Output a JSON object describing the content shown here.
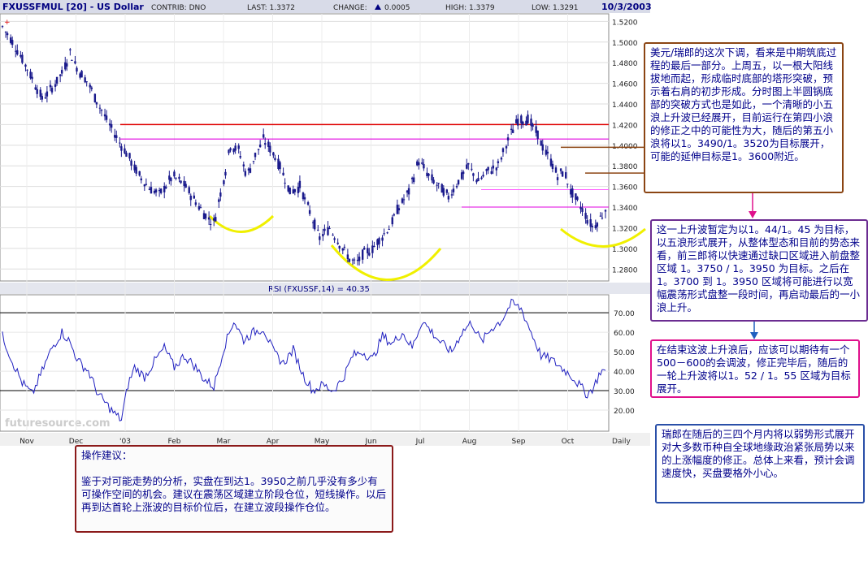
{
  "header": {
    "symbol": "FXUSSFMUL [20] - US Dollar",
    "contrib": "CONTRIB: DNO",
    "last": "LAST: 1.3372",
    "change_label": "CHANGE:",
    "change_value": "0.0005",
    "high": "HIGH: 1.3379",
    "low": "LOW: 1.3291",
    "date": "10/3/2003"
  },
  "rsi_label": "RSI (FXUSSF,14) = 40.35",
  "watermark": "futuresource.com",
  "period_label": "Daily",
  "chart_data": [
    {
      "type": "candlestick",
      "title": "FXUSSFMUL [20] - US Dollar",
      "ylim": [
        1.27,
        1.525
      ],
      "y_ticks": [
        1.28,
        1.3,
        1.32,
        1.34,
        1.36,
        1.38,
        1.4,
        1.42,
        1.44,
        1.46,
        1.48,
        1.5,
        1.52
      ],
      "x_ticks": [
        "Nov",
        "Dec",
        "'03",
        "Feb",
        "Mar",
        "Apr",
        "May",
        "Jun",
        "Jul",
        "Aug",
        "Sep",
        "Oct"
      ],
      "anchors": [
        [
          0,
          1.515
        ],
        [
          4,
          1.505
        ],
        [
          10,
          1.49
        ],
        [
          18,
          1.465
        ],
        [
          24,
          1.445
        ],
        [
          30,
          1.455
        ],
        [
          36,
          1.47
        ],
        [
          41,
          1.49
        ],
        [
          45,
          1.475
        ],
        [
          52,
          1.46
        ],
        [
          58,
          1.44
        ],
        [
          63,
          1.425
        ],
        [
          70,
          1.405
        ],
        [
          76,
          1.39
        ],
        [
          82,
          1.372
        ],
        [
          88,
          1.36
        ],
        [
          95,
          1.352
        ],
        [
          103,
          1.37
        ],
        [
          110,
          1.362
        ],
        [
          117,
          1.345
        ],
        [
          124,
          1.33
        ],
        [
          128,
          1.325
        ],
        [
          133,
          1.36
        ],
        [
          138,
          1.4
        ],
        [
          143,
          1.395
        ],
        [
          148,
          1.37
        ],
        [
          153,
          1.39
        ],
        [
          158,
          1.405
        ],
        [
          163,
          1.395
        ],
        [
          168,
          1.38
        ],
        [
          174,
          1.355
        ],
        [
          180,
          1.36
        ],
        [
          186,
          1.335
        ],
        [
          192,
          1.31
        ],
        [
          198,
          1.32
        ],
        [
          204,
          1.305
        ],
        [
          210,
          1.29
        ],
        [
          214,
          1.285
        ],
        [
          219,
          1.295
        ],
        [
          224,
          1.3
        ],
        [
          229,
          1.31
        ],
        [
          234,
          1.32
        ],
        [
          240,
          1.34
        ],
        [
          246,
          1.355
        ],
        [
          252,
          1.385
        ],
        [
          258,
          1.37
        ],
        [
          264,
          1.36
        ],
        [
          270,
          1.35
        ],
        [
          276,
          1.365
        ],
        [
          282,
          1.38
        ],
        [
          288,
          1.365
        ],
        [
          294,
          1.375
        ],
        [
          300,
          1.38
        ],
        [
          306,
          1.405
        ],
        [
          312,
          1.425
        ],
        [
          318,
          1.425
        ],
        [
          324,
          1.41
        ],
        [
          328,
          1.395
        ],
        [
          332,
          1.385
        ],
        [
          336,
          1.37
        ],
        [
          340,
          1.375
        ],
        [
          344,
          1.355
        ],
        [
          348,
          1.345
        ],
        [
          352,
          1.335
        ],
        [
          355,
          1.325
        ],
        [
          358,
          1.32
        ],
        [
          362,
          1.33
        ],
        [
          365,
          1.337
        ]
      ],
      "last": 1.3372,
      "high": 1.3379,
      "low": 1.3291,
      "resistance_lines": [
        {
          "value": 1.42,
          "color": "#e00000"
        },
        {
          "value": 1.406,
          "color": "#e000e0"
        },
        {
          "value": 1.357,
          "color": "#ff60ff"
        },
        {
          "value": 1.34,
          "color": "#e000e0"
        }
      ],
      "annotation_lines": [
        {
          "value": 1.398,
          "color": "#8b4513"
        },
        {
          "value": 1.373,
          "color": "#8b4513"
        }
      ]
    },
    {
      "type": "line",
      "title": "RSI (FXUSSF,14) = 40.35",
      "ylim": [
        10,
        78
      ],
      "y_ticks": [
        20.0,
        30.0,
        40.0,
        50.0,
        60.0,
        70.0
      ],
      "reference_lines": [
        70,
        30
      ],
      "anchors": [
        [
          0,
          58
        ],
        [
          6,
          45
        ],
        [
          12,
          34
        ],
        [
          18,
          28
        ],
        [
          24,
          40
        ],
        [
          30,
          52
        ],
        [
          36,
          60
        ],
        [
          40,
          56
        ],
        [
          46,
          45
        ],
        [
          52,
          40
        ],
        [
          58,
          28
        ],
        [
          64,
          22
        ],
        [
          68,
          18
        ],
        [
          72,
          15
        ],
        [
          76,
          33
        ],
        [
          80,
          42
        ],
        [
          86,
          37
        ],
        [
          92,
          45
        ],
        [
          98,
          52
        ],
        [
          104,
          42
        ],
        [
          110,
          48
        ],
        [
          116,
          43
        ],
        [
          122,
          36
        ],
        [
          128,
          32
        ],
        [
          134,
          52
        ],
        [
          140,
          66
        ],
        [
          146,
          56
        ],
        [
          152,
          60
        ],
        [
          158,
          62
        ],
        [
          164,
          50
        ],
        [
          170,
          44
        ],
        [
          176,
          51
        ],
        [
          182,
          38
        ],
        [
          188,
          30
        ],
        [
          194,
          33
        ],
        [
          200,
          30
        ],
        [
          206,
          36
        ],
        [
          212,
          48
        ],
        [
          218,
          50
        ],
        [
          224,
          46
        ],
        [
          230,
          58
        ],
        [
          236,
          54
        ],
        [
          242,
          60
        ],
        [
          248,
          52
        ],
        [
          254,
          66
        ],
        [
          260,
          60
        ],
        [
          266,
          54
        ],
        [
          272,
          50
        ],
        [
          278,
          60
        ],
        [
          284,
          65
        ],
        [
          290,
          55
        ],
        [
          296,
          62
        ],
        [
          302,
          66
        ],
        [
          308,
          75
        ],
        [
          314,
          72
        ],
        [
          320,
          60
        ],
        [
          326,
          48
        ],
        [
          332,
          46
        ],
        [
          338,
          42
        ],
        [
          344,
          38
        ],
        [
          350,
          32
        ],
        [
          354,
          28
        ],
        [
          358,
          32
        ],
        [
          362,
          40
        ],
        [
          365,
          40.35
        ]
      ]
    }
  ],
  "notes": {
    "n1": "美元/瑞郎的这次下调，看来是中期筑底过程的最后一部分。上周五，以一根大阳线拔地而起，形成临时底部的塔形突破，预示着右肩的初步形成。分时图上半圆锅底部的突破方式也是如此，一个清晰的小五浪上升波已经展开，目前运行在第四小浪的修正之中的可能性为大，随后的第五小浪将以1。3490/1。3520为目标展开，可能的延伸目标是1。3600附近。",
    "n2": "这一上升波暂定为以1。44/1。45 为目标，以五浪形式展开，从整体型态和目前的势态来看，前三郎将以快速通过缺口区域进入前盘整区域 1。3750 / 1。3950 为目标。之后在1。3700 到 1。3950 区域将可能进行以宽幅震荡形式盘整一段时间，再启动最后的一小浪上升。",
    "n3": "在结束这波上升浪后，应该可以期待有一个500－600的会调波，修正完毕后，随后的一轮上升波将以1。52 / 1。55 区域为目标展开。",
    "n4": "瑞郎在随后的三四个月内将以弱势形式展开对大多数币种自全球地缘政治紧张局势以来的上涨幅度的修正。总体上来看，预计会调速度快，买盘要格外小心。",
    "n5_title": "操作建议：",
    "n5_body": "鉴于对可能走势的分析，实盘在到达1。3950之前几乎没有多少有可操作空间的机会。建议在震荡区域建立阶段仓位，短线操作。以后再到达首轮上涨波的目标价位后，在建立波段操作仓位。"
  },
  "colors": {
    "header_bg": "#d8dbe8",
    "candle": "#1a1a8c",
    "rsi_line": "#2020c0",
    "smile": "#f0f000",
    "arrow": "#1f5fbf"
  }
}
